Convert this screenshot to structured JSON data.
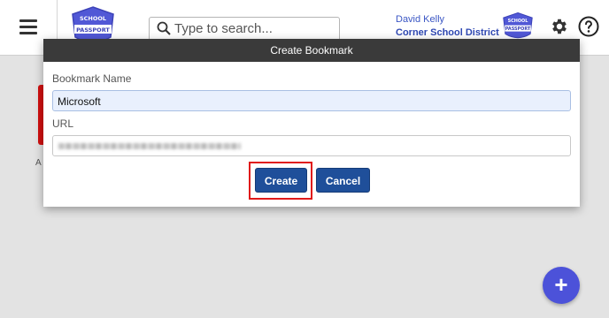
{
  "header": {
    "search_placeholder": "Type to search...",
    "user_name": "David Kelly",
    "district": "Corner School District",
    "logo_text_top": "SCHOOL",
    "logo_text_bottom": "PASSPORT"
  },
  "background": {
    "partial_label": "A"
  },
  "modal": {
    "title": "Create Bookmark",
    "name_label": "Bookmark Name",
    "name_value": "Microsoft",
    "url_label": "URL",
    "create_label": "Create",
    "cancel_label": "Cancel"
  },
  "fab": {
    "label": "+"
  },
  "colors": {
    "accent": "#1f4f9a",
    "fab": "#4c52d9",
    "highlight": "#e01919",
    "modal_header": "#3a3a3a"
  }
}
